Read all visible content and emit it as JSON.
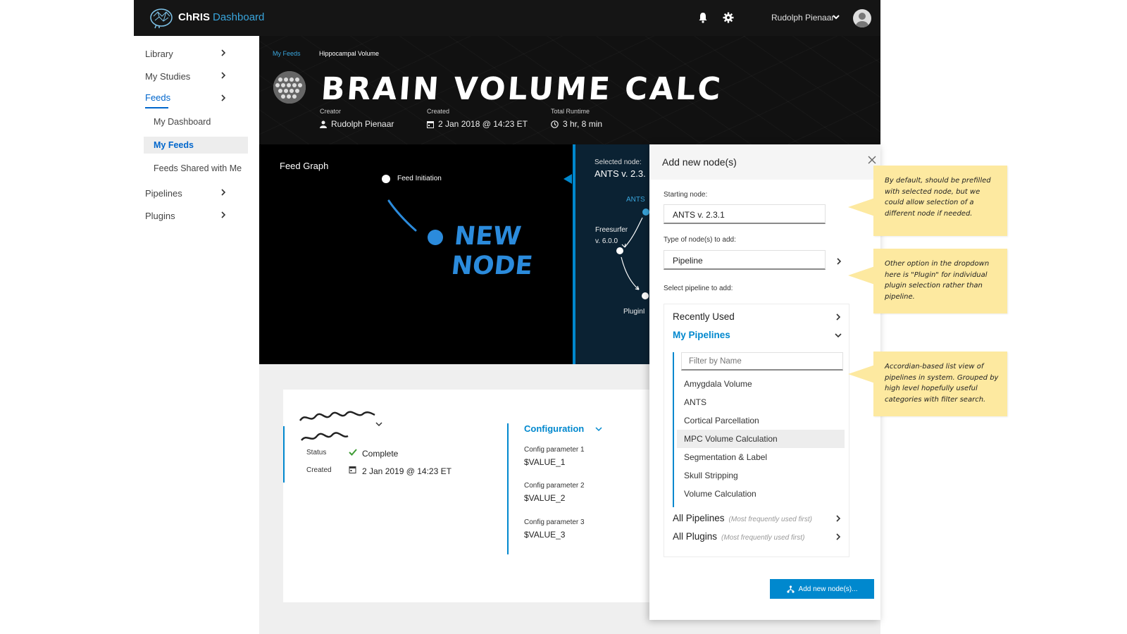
{
  "app": {
    "brand": "ChRIS",
    "brand_sub": "Dashboard",
    "user_name": "Rudolph Pienaar"
  },
  "sidebar": {
    "items": [
      {
        "label": "Library"
      },
      {
        "label": "My Studies"
      },
      {
        "label": "Feeds"
      },
      {
        "label": "Pipelines"
      },
      {
        "label": "Plugins"
      }
    ],
    "feeds_sub": [
      {
        "label": "My Dashboard"
      },
      {
        "label": "My Feeds"
      },
      {
        "label": "Feeds Shared with Me"
      }
    ]
  },
  "header": {
    "breadcrumb": [
      "My Feeds",
      "Hippocampal Volume"
    ],
    "title": "BRAIN VOLUME CALC",
    "creator_label": "Creator",
    "creator": "Rudolph Pienaar",
    "created_label": "Created",
    "created": "2 Jan 2018 @ 14:23 ET",
    "runtime_label": "Total Runtime",
    "runtime": "3 hr, 8 min"
  },
  "graph": {
    "title": "Feed Graph",
    "initiation_label": "Feed Initiation",
    "new_node_line1": "NEW",
    "new_node_line2": "NODE",
    "selected_label": "Selected node:",
    "selected_value": "ANTS v. 2.3.",
    "node_ants": "ANTS",
    "node_freesurfer_1": "Freesurfer",
    "node_freesurfer_2": "v. 6.0.0",
    "node_plugin": "PluginI"
  },
  "details": {
    "status_label": "Status",
    "status_value": "Complete",
    "created_label": "Created",
    "created_value": "2 Jan 2019 @ 14:23 ET",
    "config_header": "Configuration",
    "params": [
      {
        "label": "Config parameter 1",
        "value": "$VALUE_1"
      },
      {
        "label": "Config parameter 2",
        "value": "$VALUE_2"
      },
      {
        "label": "Config parameter 3",
        "value": "$VALUE_3"
      }
    ]
  },
  "modal": {
    "title": "Add new node(s)",
    "starting_node_label": "Starting node:",
    "starting_node_value": "ANTS v. 2.3.1",
    "type_label": "Type of node(s) to add:",
    "type_value": "Pipeline",
    "select_label": "Select pipeline to add:",
    "recently_used": "Recently Used",
    "my_pipelines": "My Pipelines",
    "filter_placeholder": "Filter by Name",
    "pipelines": [
      "Amygdala Volume",
      "ANTS",
      "Cortical Parcellation",
      "MPC Volume Calculation",
      "Segmentation & Label",
      "Skull Stripping",
      "Volume Calculation"
    ],
    "all_pipelines": "All Pipelines",
    "all_pipelines_hint": "(Most frequently used first)",
    "all_plugins": "All Plugins",
    "all_plugins_hint": "(Most frequently used first)",
    "add_button": "Add new node(s)..."
  },
  "notes": [
    "By default, should be prefilled with selected node, but we could allow selection of a different node if needed.",
    "Other option in the dropdown here is \"Plugin\" for individual plugin selection rather than pipeline.",
    "Accordian-based list view of pipelines in system. Grouped by high level hopefully useful categories with filter search."
  ],
  "colors": {
    "accent": "#0088ce",
    "link": "#0066cc",
    "note": "#fde9a0",
    "success": "#3f9c35"
  }
}
